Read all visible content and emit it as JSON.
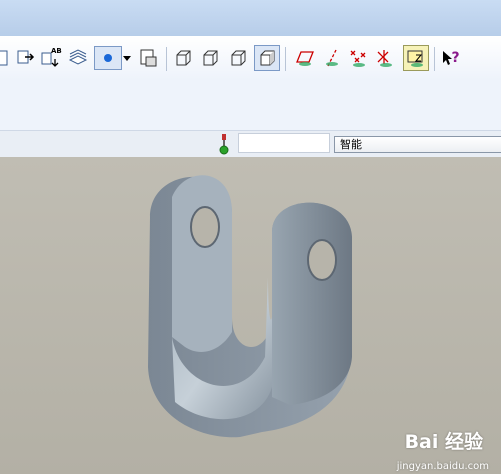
{
  "toolbar": {
    "buttons": [
      {
        "name": "new-icon"
      },
      {
        "name": "insert-icon"
      },
      {
        "name": "annotation-icon"
      },
      {
        "name": "layers-icon"
      },
      {
        "name": "render-style-icon"
      },
      {
        "name": "print-icon"
      },
      {
        "name": "wireframe-icon"
      },
      {
        "name": "hidden-line-icon"
      },
      {
        "name": "no-hidden-icon"
      },
      {
        "name": "shaded-icon"
      },
      {
        "name": "datum-plane-icon"
      },
      {
        "name": "datum-axis-icon"
      },
      {
        "name": "datum-point-icon"
      },
      {
        "name": "coordinate-system-icon"
      },
      {
        "name": "annotation-display-icon"
      },
      {
        "name": "context-help-icon"
      }
    ],
    "ab_label": "AB",
    "help_mark": "?"
  },
  "statusbar": {
    "filter_value": "智能"
  },
  "colors": {
    "viewport_bg": "#b8b5aa",
    "part_color": "#8e9aa6",
    "status_light": "#2aa12a"
  },
  "watermark": {
    "brand": "Bai 经验",
    "site": "jingyan.baidu.com"
  }
}
